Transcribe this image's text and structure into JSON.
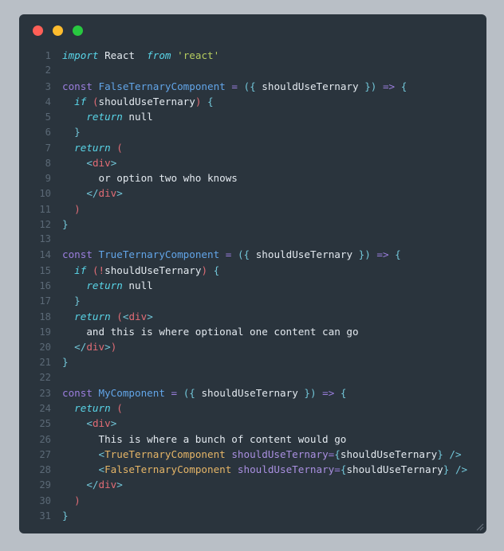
{
  "window": {
    "title": "",
    "background_color": "#b9bfc6",
    "editor_background": "#2a343d",
    "traffic_lights": [
      {
        "name": "close",
        "color": "#ff5f57"
      },
      {
        "name": "minimize",
        "color": "#febc2e"
      },
      {
        "name": "maximize",
        "color": "#28c840"
      }
    ]
  },
  "editor": {
    "language": "jsx",
    "total_lines": 31,
    "line_numbers": [
      "1",
      "2",
      "3",
      "4",
      "5",
      "6",
      "7",
      "8",
      "9",
      "10",
      "11",
      "12",
      "13",
      "14",
      "15",
      "16",
      "17",
      "18",
      "19",
      "20",
      "21",
      "22",
      "23",
      "24",
      "25",
      "26",
      "27",
      "28",
      "29",
      "30",
      "31"
    ],
    "lines": [
      {
        "n": "1",
        "text": "import React  from 'react'"
      },
      {
        "n": "2",
        "text": ""
      },
      {
        "n": "3",
        "text": "const FalseTernaryComponent = ({ shouldUseTernary }) => {"
      },
      {
        "n": "4",
        "text": "  if (shouldUseTernary) {"
      },
      {
        "n": "5",
        "text": "    return null"
      },
      {
        "n": "6",
        "text": "  }"
      },
      {
        "n": "7",
        "text": "  return ("
      },
      {
        "n": "8",
        "text": "    <div>"
      },
      {
        "n": "9",
        "text": "      or option two who knows"
      },
      {
        "n": "10",
        "text": "    </div>"
      },
      {
        "n": "11",
        "text": "  )"
      },
      {
        "n": "12",
        "text": "}"
      },
      {
        "n": "13",
        "text": ""
      },
      {
        "n": "14",
        "text": "const TrueTernaryComponent = ({ shouldUseTernary }) => {"
      },
      {
        "n": "15",
        "text": "  if (!shouldUseTernary) {"
      },
      {
        "n": "16",
        "text": "    return null"
      },
      {
        "n": "17",
        "text": "  }"
      },
      {
        "n": "18",
        "text": "  return (<div>"
      },
      {
        "n": "19",
        "text": "    and this is where optional one content can go"
      },
      {
        "n": "20",
        "text": "  </div>)"
      },
      {
        "n": "21",
        "text": "}"
      },
      {
        "n": "22",
        "text": ""
      },
      {
        "n": "23",
        "text": "const MyComponent = ({ shouldUseTernary }) => {"
      },
      {
        "n": "24",
        "text": "  return ("
      },
      {
        "n": "25",
        "text": "    <div>"
      },
      {
        "n": "26",
        "text": "      This is where a bunch of content would go"
      },
      {
        "n": "27",
        "text": "      <TrueTernaryComponent shouldUseTernary={shouldUseTernary} />"
      },
      {
        "n": "28",
        "text": "      <FalseTernaryComponent shouldUseTernary={shouldUseTernary} />"
      },
      {
        "n": "29",
        "text": "    </div>"
      },
      {
        "n": "30",
        "text": "  )"
      },
      {
        "n": "31",
        "text": "}"
      }
    ],
    "tokens": {
      "keyword_color": "#59d5e8",
      "const_color": "#9b7ede",
      "function_color": "#62a5e8",
      "string_color": "#b5cc5f",
      "plain_color": "#e3e9ef",
      "punctuation_color": "#72c6d8",
      "operator_color": "#9b7ede",
      "tag_color": "#e06c75",
      "component_color": "#e5b567",
      "attribute_color": "#a98fe0",
      "line_number_color": "#5b6976"
    }
  }
}
